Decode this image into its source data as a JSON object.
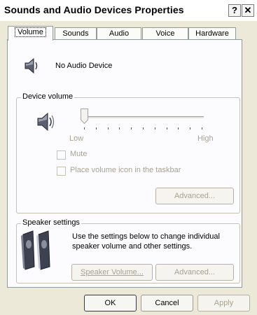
{
  "window": {
    "title": "Sounds and Audio Devices Properties",
    "help_glyph": "?",
    "close_glyph": "✕"
  },
  "tabs": [
    {
      "label": "Volume"
    },
    {
      "label": "Sounds"
    },
    {
      "label": "Audio"
    },
    {
      "label": "Voice"
    },
    {
      "label": "Hardware"
    }
  ],
  "device": {
    "name": "No Audio Device"
  },
  "device_volume": {
    "group_label": "Device volume",
    "low_label": "Low",
    "high_label": "High",
    "slider_level": 0,
    "mute_label": "Mute",
    "taskbar_label": "Place volume icon in the taskbar",
    "advanced_label": "Advanced..."
  },
  "speaker_settings": {
    "group_label": "Speaker settings",
    "description": "Use the settings below to change individual speaker volume and other settings.",
    "speaker_volume_label": "Speaker Volume...",
    "advanced_label": "Advanced..."
  },
  "footer": {
    "ok_label": "OK",
    "cancel_label": "Cancel",
    "apply_label": "Apply"
  }
}
